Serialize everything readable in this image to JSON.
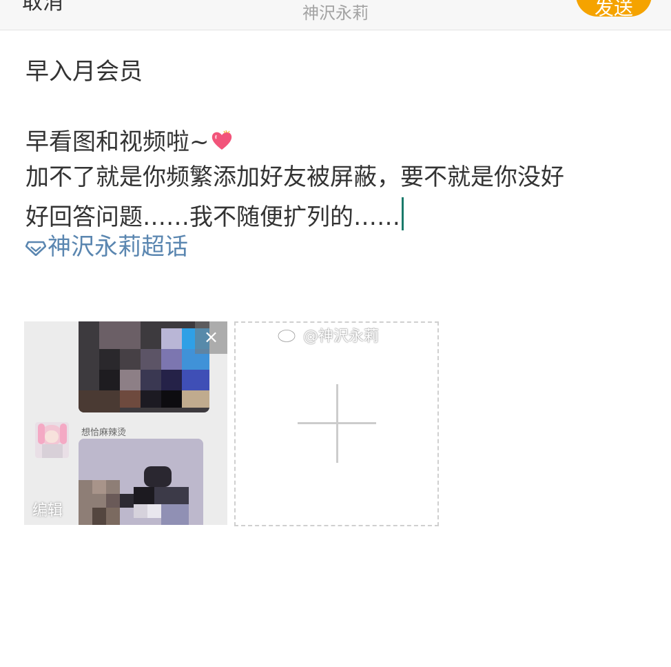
{
  "header": {
    "cancel_label": "取消",
    "title": "神沢永莉",
    "send_label": "发送"
  },
  "composer": {
    "line1": "早入月会员",
    "line2": "早看图和视频啦~",
    "line3": "加不了就是你频繁添加好友被屏蔽，要不就是你没好",
    "line4": "好回答问题……我不随便扩列的……",
    "topic": "神沢永莉超话"
  },
  "media": {
    "edit_label": "编辑",
    "close_icon": "×",
    "chat_name": "想恰麻辣烫"
  },
  "watermark": "@神沢永莉",
  "colors": {
    "accent": "#f5a300",
    "topic_link": "#5a86b0",
    "cursor": "#1a7a6a"
  },
  "icons": [
    "heart-emoji-icon",
    "supertopic-diamond-icon",
    "close-icon",
    "plus-icon",
    "weibo-logo-icon"
  ]
}
